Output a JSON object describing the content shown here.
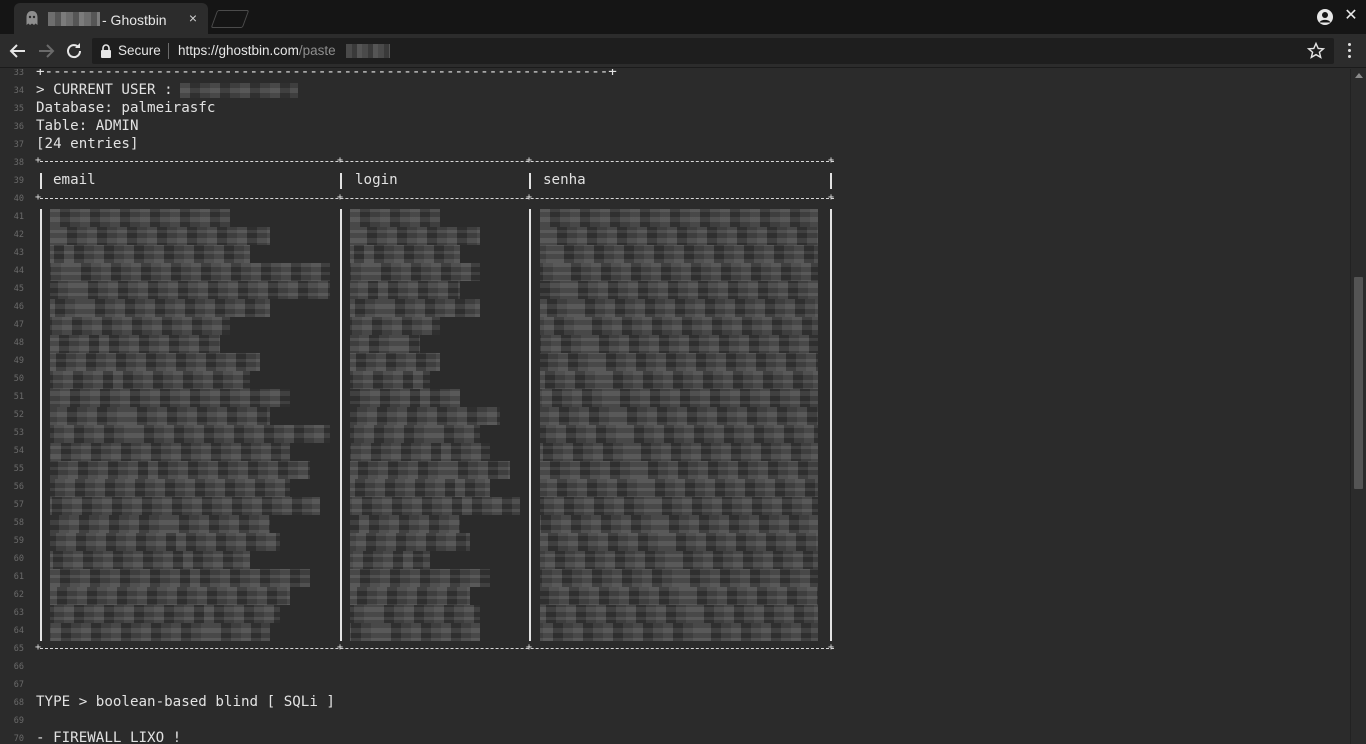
{
  "tab": {
    "title": "- Ghostbin",
    "close_icon": "×"
  },
  "window": {
    "close_icon": "✕"
  },
  "toolbar": {
    "secure_label": "Secure",
    "url_host": "https://ghostbin.com",
    "url_path": "/paste"
  },
  "paste": {
    "lines": [
      {
        "n": "33",
        "text": "+------------------------------------------------------------------+"
      },
      {
        "n": "34",
        "text": "> CURRENT USER :"
      },
      {
        "n": "35",
        "text": "Database: palmeirasfc"
      },
      {
        "n": "36",
        "text": "Table: ADMIN"
      },
      {
        "n": "37",
        "text": "[24 entries]"
      },
      {
        "n": "38",
        "text": ""
      },
      {
        "n": "39",
        "text": ""
      },
      {
        "n": "40",
        "text": ""
      },
      {
        "n": "41",
        "text": ""
      },
      {
        "n": "42",
        "text": ""
      },
      {
        "n": "43",
        "text": ""
      },
      {
        "n": "44",
        "text": ""
      },
      {
        "n": "45",
        "text": ""
      },
      {
        "n": "46",
        "text": ""
      },
      {
        "n": "47",
        "text": ""
      },
      {
        "n": "48",
        "text": ""
      },
      {
        "n": "49",
        "text": ""
      },
      {
        "n": "50",
        "text": ""
      },
      {
        "n": "51",
        "text": ""
      },
      {
        "n": "52",
        "text": ""
      },
      {
        "n": "53",
        "text": ""
      },
      {
        "n": "54",
        "text": ""
      },
      {
        "n": "55",
        "text": ""
      },
      {
        "n": "56",
        "text": ""
      },
      {
        "n": "57",
        "text": ""
      },
      {
        "n": "58",
        "text": ""
      },
      {
        "n": "59",
        "text": ""
      },
      {
        "n": "60",
        "text": ""
      },
      {
        "n": "61",
        "text": ""
      },
      {
        "n": "62",
        "text": ""
      },
      {
        "n": "63",
        "text": ""
      },
      {
        "n": "64",
        "text": ""
      },
      {
        "n": "65",
        "text": ""
      },
      {
        "n": "66",
        "text": ""
      },
      {
        "n": "67",
        "text": ""
      },
      {
        "n": "68",
        "text": "TYPE > boolean-based blind [ SQLi ]"
      },
      {
        "n": "69",
        "text": ""
      },
      {
        "n": "70",
        "text": "- FIREWALL LIXO !"
      }
    ],
    "table_headers": [
      "email",
      "login",
      "senha"
    ],
    "visible_row_count": 24
  }
}
